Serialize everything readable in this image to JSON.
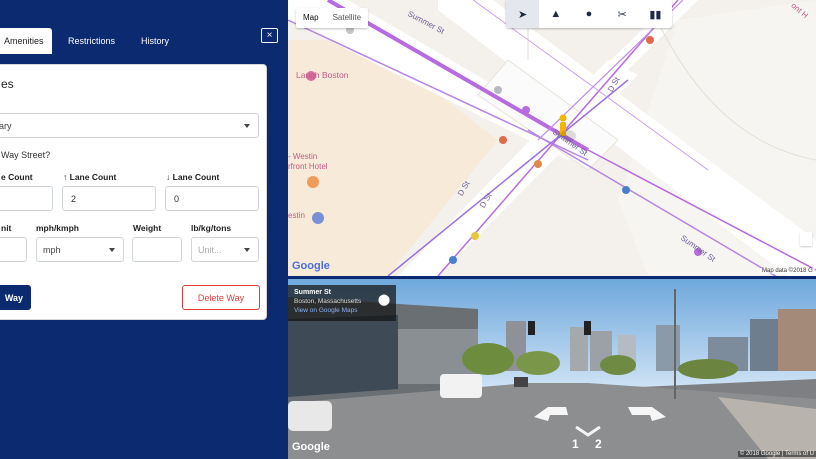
{
  "panel": {
    "tabs": [
      {
        "label": "Amenities"
      },
      {
        "label": "Restrictions"
      },
      {
        "label": "History"
      }
    ],
    "close_symbol": "×",
    "card_title": "es",
    "type_select": {
      "value": "ary"
    },
    "question": "Way Street?",
    "lane_fwd_label": "e Count",
    "lane_up_label": "Lane Count",
    "lane_down_label": "Lane Count",
    "lane_fwd_value": "",
    "lane_up_value": "2",
    "lane_down_value": "0",
    "limit_label": "nit",
    "speed_unit_label": "mph/kmph",
    "weight_label": "Weight",
    "weight_unit_label": "lb/kg/tons",
    "speed_unit_value": "mph",
    "weight_value": "",
    "weight_unit_placeholder": "Unit...",
    "save_label": "Way",
    "delete_label": "Delete Way"
  },
  "map": {
    "type_map": "Map",
    "type_satellite": "Satellite",
    "tools": [
      "pointer-icon",
      "road-icon",
      "pin-icon",
      "scissors-icon",
      "layers-icon"
    ],
    "pois": [
      "Laugh Boston",
      "- Westin",
      "rfront Hotel",
      "estin"
    ],
    "streets": [
      "Summer St",
      "D St",
      "D St",
      "D St",
      "Summer St",
      "Summer St"
    ],
    "attribution": "Map data ©2018 G",
    "google": "Google",
    "corner_text": "ont H"
  },
  "streetview": {
    "title": "Summer St",
    "subtitle": "Boston, Massachusetts",
    "link": "View on Google Maps",
    "google": "Google",
    "attribution": "© 2018 Google | Terms of U",
    "arrow_left": "1",
    "arrow_right": "2"
  }
}
